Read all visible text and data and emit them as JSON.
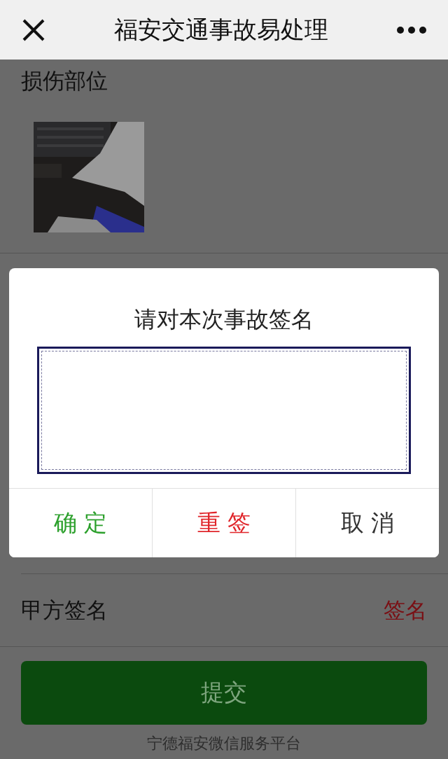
{
  "header": {
    "title": "福安交通事故易处理"
  },
  "damage_section": {
    "label": "损伤部位"
  },
  "signature_row": {
    "label": "甲方签名",
    "action": "签名"
  },
  "submit_button": {
    "label": "提交"
  },
  "footer": "宁德福安微信服务平台",
  "dialog": {
    "title": "请对本次事故签名",
    "buttons": [
      {
        "label": "确 定",
        "kind": "confirm"
      },
      {
        "label": "重 签",
        "kind": "redo"
      },
      {
        "label": "取 消",
        "kind": "cancel"
      }
    ]
  }
}
